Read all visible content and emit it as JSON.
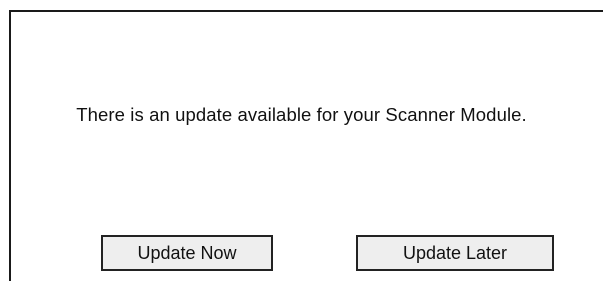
{
  "dialog": {
    "message": "There is an update available for your Scanner Module.",
    "buttons": {
      "update_now": "Update Now",
      "update_later": "Update Later"
    }
  },
  "colors": {
    "border": "#1a1a1a",
    "button_face": "#eeeeee",
    "text": "#111111"
  }
}
